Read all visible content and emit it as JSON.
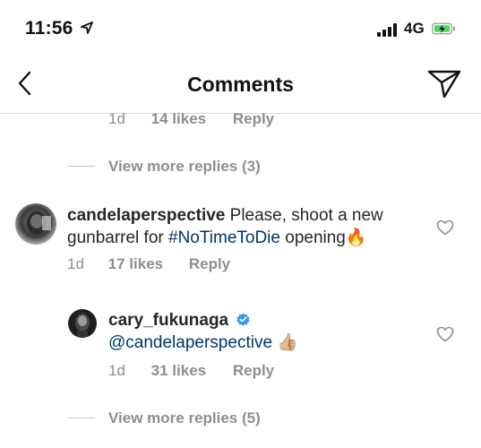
{
  "status_bar": {
    "time": "11:56",
    "network": "4G"
  },
  "header": {
    "title": "Comments"
  },
  "top_meta": {
    "age": "1d",
    "likes": "14 likes",
    "reply": "Reply"
  },
  "view_more_1": {
    "label": "View more replies (3)"
  },
  "comment1": {
    "username": "candelaperspective",
    "text_before": " Please, shoot a new gunbarrel for ",
    "hashtag": "#NoTimeToDie",
    "text_after": " opening🔥",
    "age": "1d",
    "likes": "17 likes",
    "reply": "Reply"
  },
  "reply1": {
    "username": "cary_fukunaga",
    "mention": "@candelaperspective",
    "emoji": "👍🏼",
    "age": "1d",
    "likes": "31 likes",
    "reply": "Reply"
  },
  "view_more_2": {
    "label": "View more replies (5)"
  },
  "colors": {
    "link": "#003569",
    "muted": "#8e8e8e",
    "text": "#262626",
    "verified": "#3897f0",
    "battery": "#4cd964"
  }
}
